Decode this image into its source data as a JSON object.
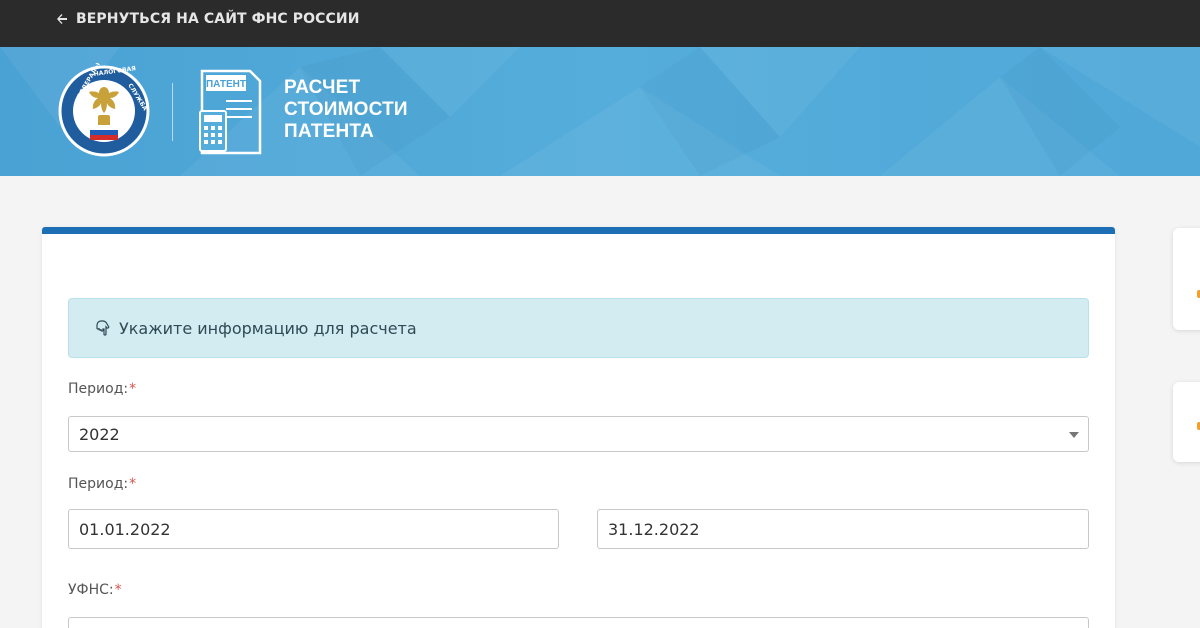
{
  "topbar": {
    "back_label": "ВЕРНУТЬСЯ НА САЙТ ФНС РОССИИ"
  },
  "header": {
    "emblem_text": "ФЕДЕРАЛЬНАЯ НАЛОГОВАЯ СЛУЖБА",
    "patent_icon_label": "ПАТЕНТ",
    "title_lines": [
      "РАСЧЕТ",
      "СТОИМОСТИ",
      "ПАТЕНТА"
    ]
  },
  "info": {
    "text": "Укажите информацию для расчета",
    "icon": "hand-pointing-icon"
  },
  "form": {
    "period_label": "Период:",
    "period_required": "*",
    "period_value": "2022",
    "dates_label": "Период:",
    "dates_required": "*",
    "date_from": "01.01.2022",
    "date_to": "31.12.2022",
    "ufns_label": "УФНС:",
    "ufns_required": "*"
  },
  "colors": {
    "topbar": "#2b2b2b",
    "header": "#4fa8d8",
    "card_accent": "#1d6fb5",
    "info_bg": "#d2ecf2",
    "required": "#d9534f"
  }
}
